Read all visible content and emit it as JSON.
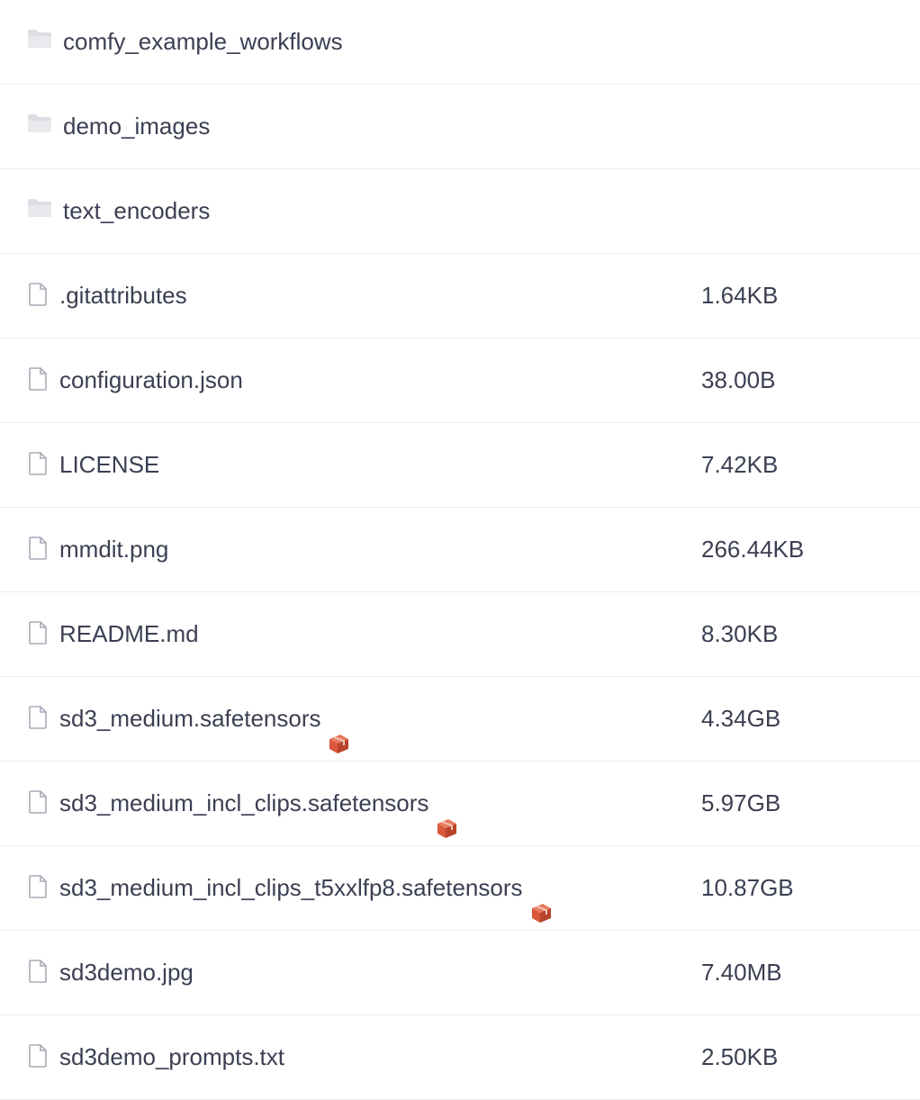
{
  "folders": [
    {
      "name": "comfy_example_workflows",
      "icon": "folder-icon"
    },
    {
      "name": "demo_images",
      "icon": "folder-icon"
    },
    {
      "name": "text_encoders",
      "icon": "folder-icon"
    }
  ],
  "files": [
    {
      "name": ".gitattributes",
      "size": "1.64KB",
      "icon": "file-icon",
      "lfs": false
    },
    {
      "name": "configuration.json",
      "size": "38.00B",
      "icon": "file-icon",
      "lfs": false
    },
    {
      "name": "LICENSE",
      "size": "7.42KB",
      "icon": "file-icon",
      "lfs": false
    },
    {
      "name": "mmdit.png",
      "size": "266.44KB",
      "icon": "file-icon",
      "lfs": false
    },
    {
      "name": "README.md",
      "size": "8.30KB",
      "icon": "file-icon",
      "lfs": false
    },
    {
      "name": "sd3_medium.safetensors",
      "size": "4.34GB",
      "icon": "file-icon",
      "lfs": true
    },
    {
      "name": "sd3_medium_incl_clips.safetensors",
      "size": "5.97GB",
      "icon": "file-icon",
      "lfs": true
    },
    {
      "name": "sd3_medium_incl_clips_t5xxlfp8.safetensors",
      "size": "10.87GB",
      "icon": "file-icon",
      "lfs": true
    },
    {
      "name": "sd3demo.jpg",
      "size": "7.40MB",
      "icon": "file-icon",
      "lfs": false
    },
    {
      "name": "sd3demo_prompts.txt",
      "size": "2.50KB",
      "icon": "file-icon",
      "lfs": false
    }
  ],
  "colors": {
    "text": "#3b3f52",
    "divider": "#ececef",
    "icon": "#a8abb8",
    "lfs_badge": "#d9573b"
  }
}
